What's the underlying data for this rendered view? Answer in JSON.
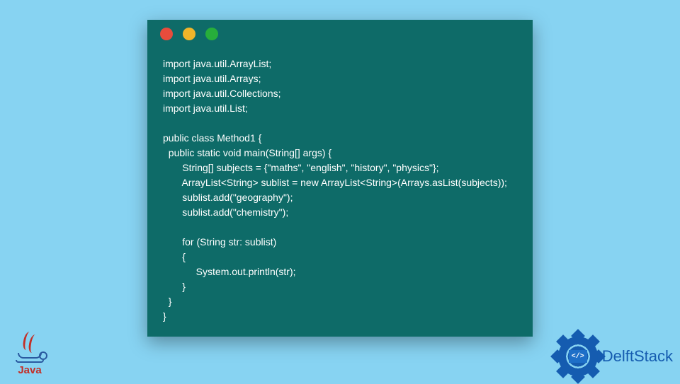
{
  "code_window": {
    "lines": "import java.util.ArrayList;\nimport java.util.Arrays;\nimport java.util.Collections;\nimport java.util.List;\n\npublic class Method1 {\n  public static void main(String[] args) {\n       String[] subjects = {\"maths\", \"english\", \"history\", \"physics\"};\n       ArrayList<String> sublist = new ArrayList<String>(Arrays.asList(subjects));\n       sublist.add(\"geography\");\n       sublist.add(\"chemistry\");\n\n       for (String str: sublist)\n       {\n            System.out.println(str);\n       }\n  }\n}"
  },
  "logos": {
    "java_label": "Java",
    "delftstack_label": "DelftStack",
    "delftstack_badge": "</>"
  }
}
